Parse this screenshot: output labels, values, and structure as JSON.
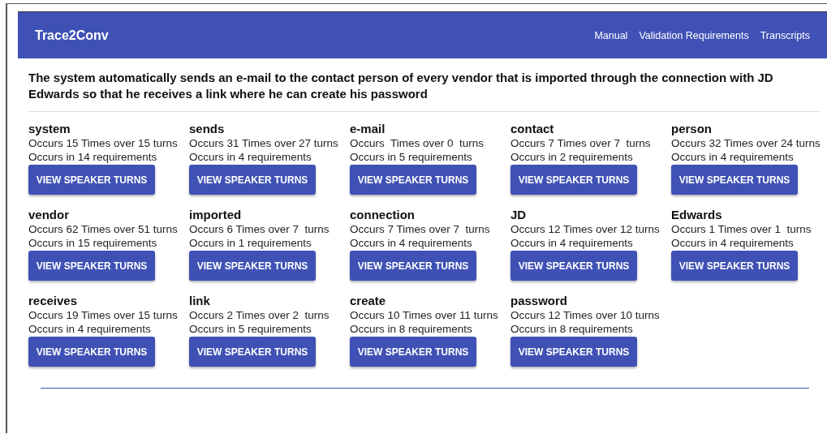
{
  "app_bar": {
    "title": "Trace2Conv",
    "links": [
      "Manual",
      "Validation Requirements",
      "Transcripts"
    ]
  },
  "sentence": "The system automatically sends an e-mail to the contact person of every vendor that is imported through the connection with JD Edwards so that he receives a link where he can create his password",
  "words": [
    {
      "word": "system",
      "occurrences": "Occurs 15 Times over 15 turns",
      "requirements": "Occurs in 14 requirements",
      "button": "VIEW SPEAKER TURNS"
    },
    {
      "word": "sends",
      "occurrences": "Occurs 31 Times over 27 turns",
      "requirements": "Occurs in 4 requirements",
      "button": "VIEW SPEAKER TURNS"
    },
    {
      "word": "e-mail",
      "occurrences": "Occurs  Times over 0  turns",
      "requirements": "Occurs in 5 requirements",
      "button": "VIEW SPEAKER TURNS"
    },
    {
      "word": "contact",
      "occurrences": "Occurs 7 Times over 7  turns",
      "requirements": "Occurs in 2 requirements",
      "button": "VIEW SPEAKER TURNS"
    },
    {
      "word": "person",
      "occurrences": "Occurs 32 Times over 24 turns",
      "requirements": "Occurs in 4 requirements",
      "button": "VIEW SPEAKER TURNS"
    },
    {
      "word": "vendor",
      "occurrences": "Occurs 62 Times over 51 turns",
      "requirements": "Occurs in 15 requirements",
      "button": "VIEW SPEAKER TURNS"
    },
    {
      "word": "imported",
      "occurrences": "Occurs 6 Times over 7  turns",
      "requirements": "Occurs in 1 requirements",
      "button": "VIEW SPEAKER TURNS"
    },
    {
      "word": "connection",
      "occurrences": "Occurs 7 Times over 7  turns",
      "requirements": "Occurs in 4 requirements",
      "button": "VIEW SPEAKER TURNS"
    },
    {
      "word": "JD",
      "occurrences": "Occurs 12 Times over 12 turns",
      "requirements": "Occurs in 4 requirements",
      "button": "VIEW SPEAKER TURNS"
    },
    {
      "word": "Edwards",
      "occurrences": "Occurs 1 Times over 1  turns",
      "requirements": "Occurs in 4 requirements",
      "button": "VIEW SPEAKER TURNS"
    },
    {
      "word": "receives",
      "occurrences": "Occurs 19 Times over 15 turns",
      "requirements": "Occurs in 4 requirements",
      "button": "VIEW SPEAKER TURNS"
    },
    {
      "word": "link",
      "occurrences": "Occurs 2 Times over 2  turns",
      "requirements": "Occurs in 5 requirements",
      "button": "VIEW SPEAKER TURNS"
    },
    {
      "word": "create",
      "occurrences": "Occurs 10 Times over 11 turns",
      "requirements": "Occurs in 8 requirements",
      "button": "VIEW SPEAKER TURNS"
    },
    {
      "word": "password",
      "occurrences": "Occurs 12 Times over 10 turns",
      "requirements": "Occurs in 8 requirements",
      "button": "VIEW SPEAKER TURNS"
    }
  ]
}
